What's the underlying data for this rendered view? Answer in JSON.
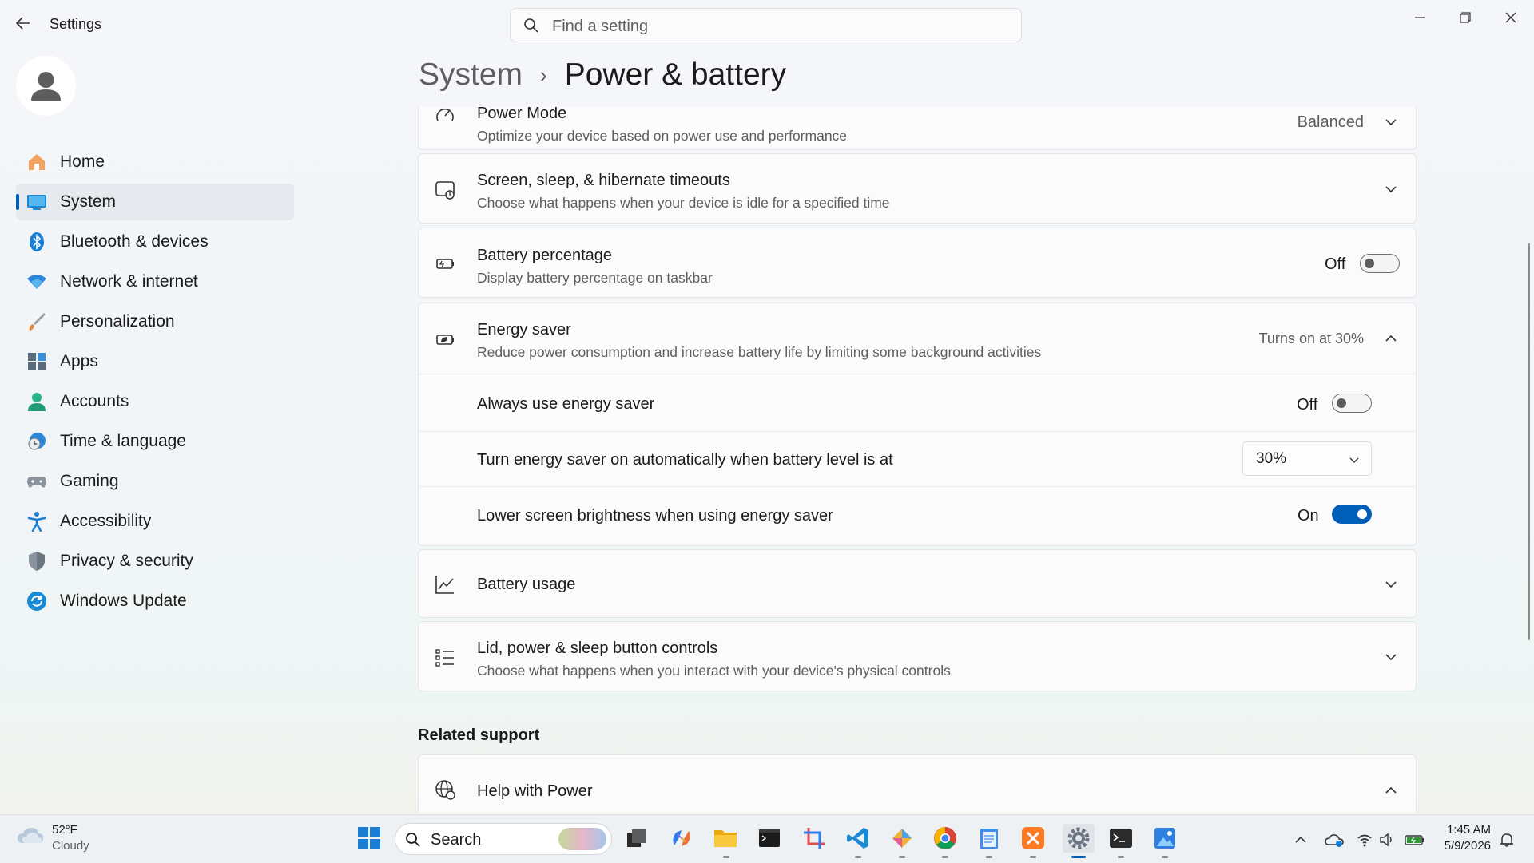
{
  "window": {
    "app_title": "Settings",
    "controls": {
      "minimize": "—",
      "restore": "❐",
      "close": "✕"
    }
  },
  "search": {
    "placeholder": "Find a setting"
  },
  "nav": {
    "items": [
      {
        "label": "Home",
        "icon": "home-icon"
      },
      {
        "label": "System",
        "icon": "system-icon",
        "active": true
      },
      {
        "label": "Bluetooth & devices",
        "icon": "bluetooth-icon"
      },
      {
        "label": "Network & internet",
        "icon": "wifi-icon"
      },
      {
        "label": "Personalization",
        "icon": "brush-icon"
      },
      {
        "label": "Apps",
        "icon": "apps-icon"
      },
      {
        "label": "Accounts",
        "icon": "accounts-icon"
      },
      {
        "label": "Time & language",
        "icon": "clock-globe-icon"
      },
      {
        "label": "Gaming",
        "icon": "gamepad-icon"
      },
      {
        "label": "Accessibility",
        "icon": "accessibility-icon"
      },
      {
        "label": "Privacy & security",
        "icon": "shield-icon"
      },
      {
        "label": "Windows Update",
        "icon": "update-icon"
      }
    ]
  },
  "breadcrumb": {
    "root": "System",
    "separator": "›",
    "current": "Power & battery"
  },
  "settings": {
    "power_mode": {
      "title": "Power Mode",
      "desc": "Optimize your device based on power use and performance",
      "value": "Balanced"
    },
    "timeouts": {
      "title": "Screen, sleep, & hibernate timeouts",
      "desc": "Choose what happens when your device is idle for a specified time"
    },
    "battery_pct": {
      "title": "Battery percentage",
      "desc": "Display battery percentage on taskbar",
      "state": "Off"
    },
    "energy_saver": {
      "title": "Energy saver",
      "desc": "Reduce power consumption and increase battery life by limiting some background activities",
      "status": "Turns on at 30%",
      "always": {
        "label": "Always use energy saver",
        "state": "Off"
      },
      "auto": {
        "label": "Turn energy saver on automatically when battery level is at",
        "value": "30%"
      },
      "brightness": {
        "label": "Lower screen brightness when using energy saver",
        "state": "On"
      }
    },
    "battery_usage": {
      "title": "Battery usage"
    },
    "lid": {
      "title": "Lid, power & sleep button controls",
      "desc": "Choose what happens when you interact with your device's physical controls"
    }
  },
  "related": {
    "heading": "Related support",
    "help": "Help with Power"
  },
  "taskbar": {
    "weather": {
      "temp": "52°F",
      "condition": "Cloudy"
    },
    "search_label": "Search",
    "apps": [
      "start-icon",
      "task-view-icon",
      "copilot-icon",
      "file-explorer-icon",
      "terminal-dark-icon",
      "snipping-tool-icon",
      "vscode-icon",
      "paint-icon",
      "chrome-icon",
      "notepad-icon",
      "xampp-icon",
      "settings-icon",
      "terminal-icon",
      "photos-icon"
    ],
    "clock": {
      "time": "1:45 AM",
      "date": "5/9/2026"
    }
  },
  "colors": {
    "accent": "#005fb8",
    "toggle_on": "#005fb8"
  }
}
